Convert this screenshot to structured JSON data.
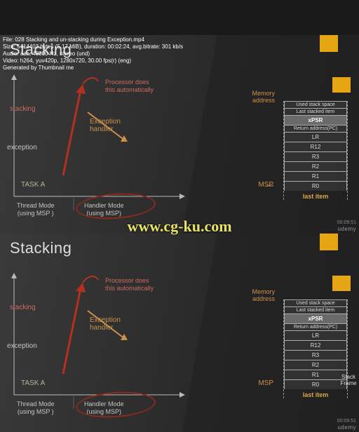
{
  "meta": {
    "line1": "File: 028 Stacking and un-stacking during Exception.mp4",
    "line2": "Size: 5414403 bytes (5.17 MiB), duration: 00:02:24, avg.bitrate: 301 kb/s",
    "line3": "Audio: aac, 48000 Hz, stereo (und)",
    "line4": "Video: h264, yuv420p, 1280x720, 30.00 fps(r) (eng)",
    "line5": "Generated by Thumbnail me"
  },
  "watermark": "www.cg-ku.com",
  "slide": {
    "title": "Stacking",
    "stacking_label": "stacking",
    "exception_label": "exception",
    "processor_note_l1": "Processor does",
    "processor_note_l2": "this automatically",
    "exception_handler_l1": "Exception",
    "exception_handler_l2": "handler",
    "task_a": "TASK A",
    "thread_mode_l1": "Thread Mode",
    "thread_mode_l2": "(using MSP )",
    "handler_mode_l1": "Handler Mode",
    "handler_mode_l2": "(using MSP)",
    "memory_l1": "Memory",
    "memory_l2": "address",
    "msp": "MSP",
    "stack": {
      "r0": "Used stack space",
      "r1": "Last stacked item",
      "r2": "xPSR",
      "r3": "Return address(PC)",
      "r4": "LR",
      "r5": "R12",
      "r6": "R3",
      "r7": "R2",
      "r8": "R1",
      "r9": "R0",
      "last": "last item"
    },
    "stack_frame_l1": "Stack",
    "stack_frame_l2": "Frame",
    "timestamp": "00:09:51",
    "brand": "udemy"
  }
}
